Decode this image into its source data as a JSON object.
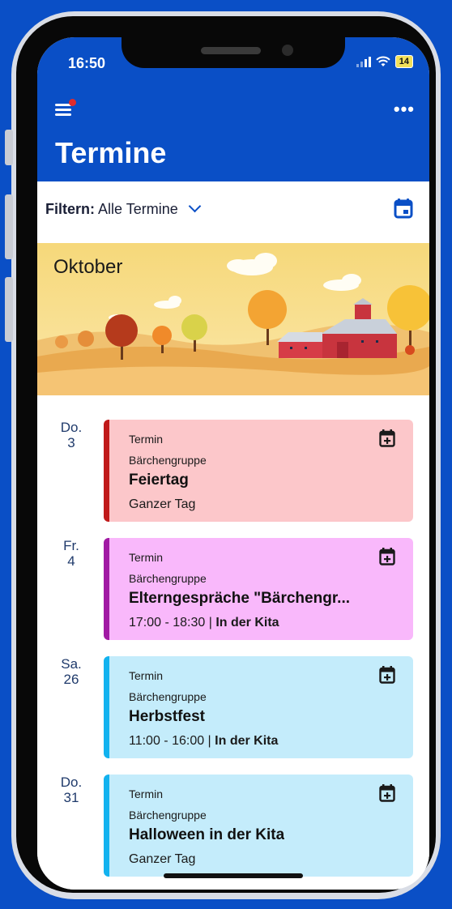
{
  "status_bar": {
    "time": "16:50",
    "battery": "14"
  },
  "header": {
    "title": "Termine"
  },
  "filter": {
    "label": "Filtern:",
    "value": "Alle Termine"
  },
  "banner": {
    "month": "Oktober"
  },
  "events": [
    {
      "weekday": "Do.",
      "day": "3",
      "kind": "Termin",
      "group": "Bärchengruppe",
      "title": "Feiertag",
      "when_time": "Ganzer Tag",
      "when_place": "",
      "bg": "#fcc7ca",
      "accent": "#c01a1a"
    },
    {
      "weekday": "Fr.",
      "day": "4",
      "kind": "Termin",
      "group": "Bärchengruppe",
      "title": "Elterngespräche \"Bärchengr...",
      "when_time": "17:00 - 18:30 | ",
      "when_place": "In der Kita",
      "bg": "#f9b8fb",
      "accent": "#a11aa4"
    },
    {
      "weekday": "Sa.",
      "day": "26",
      "kind": "Termin",
      "group": "Bärchengruppe",
      "title": "Herbstfest",
      "when_time": "11:00 - 16:00 | ",
      "when_place": "In der Kita",
      "bg": "#c4ecfb",
      "accent": "#12b2ef"
    },
    {
      "weekday": "Do.",
      "day": "31",
      "kind": "Termin",
      "group": "Bärchengruppe",
      "title": "Halloween in der Kita",
      "when_time": "Ganzer Tag",
      "when_place": "",
      "bg": "#c4ecfb",
      "accent": "#12b2ef"
    }
  ],
  "colors": {
    "brand": "#0a4fc6",
    "day_text": "#1f3a6b"
  },
  "icons": {
    "menu": "hamburger-menu-icon",
    "more": "more-dots-icon",
    "calendar": "calendar-icon",
    "add_calendar": "calendar-add-icon"
  }
}
